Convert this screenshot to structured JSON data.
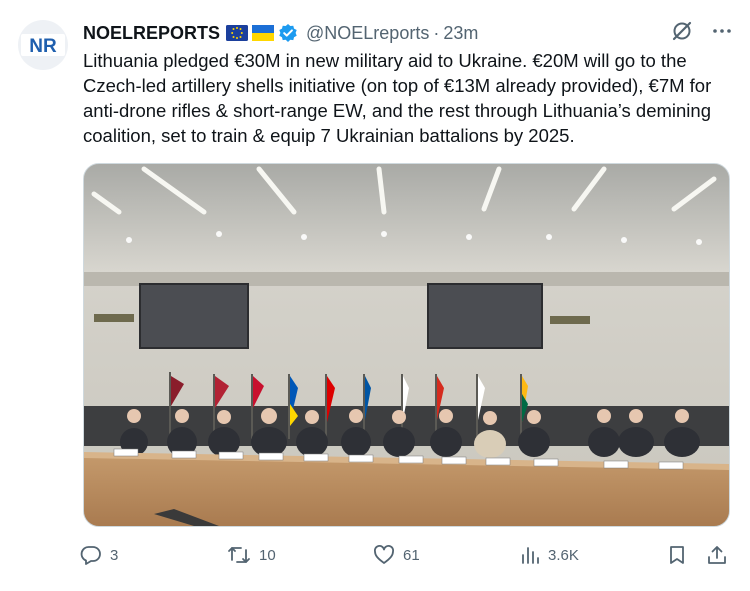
{
  "tweet": {
    "display_name": "NOELREPORTS",
    "handle": "@NOELreports",
    "separator": "·",
    "time": "23m",
    "avatar_text": "NR",
    "text": "Lithuania pledged €30M in new military aid to Ukraine. €20M will go to the Czech-led artillery shells initiative (on top of €13M already provided), €7M for anti-drone rifles & short-range EW, and the rest through Lithuania’s demining coalition, set to train & equip 7 Ukrainian battalions by 2025."
  },
  "actions": {
    "replies": "3",
    "reposts": "10",
    "likes": "61",
    "views": "3.6K"
  },
  "colors": {
    "text": "#0f1419",
    "muted": "#536471",
    "verified": "#1d9bf0",
    "avatar_blue": "#1f5fae"
  }
}
